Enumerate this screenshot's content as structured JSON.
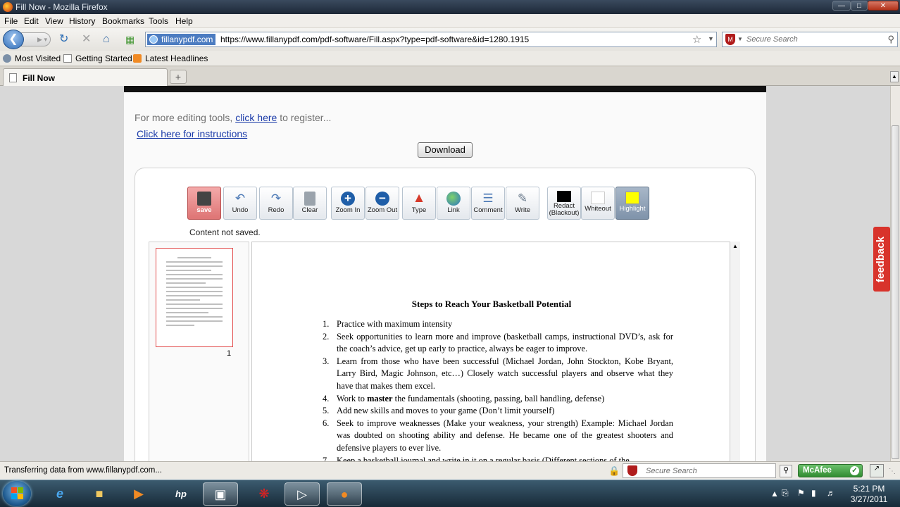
{
  "window": {
    "title": "Fill Now - Mozilla Firefox"
  },
  "menu": [
    "File",
    "Edit",
    "View",
    "History",
    "Bookmarks",
    "Tools",
    "Help"
  ],
  "nav": {
    "site_label": "fillanypdf.com",
    "url": "https://www.fillanypdf.com/pdf-software/Fill.aspx?type=pdf-software&id=1280.1915",
    "search_placeholder": "Secure Search"
  },
  "bookmarks": [
    "Most Visited",
    "Getting Started",
    "Latest Headlines"
  ],
  "tabs": [
    {
      "label": "Fill Now"
    }
  ],
  "page": {
    "edit_prefix": "For more editing tools,",
    "edit_link": "click here",
    "edit_suffix": "to register...",
    "instructions": "Click here for instructions",
    "download": "Download",
    "status": "Content not saved.",
    "thumb_page": "1",
    "feedback": "feedback"
  },
  "toolbar": [
    {
      "label": "save",
      "icon": "floppy-icon"
    },
    {
      "label": "Undo",
      "icon": "undo-icon"
    },
    {
      "label": "Redo",
      "icon": "redo-icon"
    },
    {
      "label": "Clear",
      "icon": "trash-icon"
    },
    {
      "label": "Zoom In",
      "icon": "zoom-in-icon"
    },
    {
      "label": "Zoom Out",
      "icon": "zoom-out-icon"
    },
    {
      "label": "Type",
      "icon": "type-icon"
    },
    {
      "label": "Link",
      "icon": "link-icon"
    },
    {
      "label": "Comment",
      "icon": "comment-icon"
    },
    {
      "label": "Write",
      "icon": "pencil-icon"
    },
    {
      "label": "Redact (Blackout)",
      "icon": "black-square-icon"
    },
    {
      "label": "Whiteout",
      "icon": "white-square-icon"
    },
    {
      "label": "Highlight",
      "icon": "yellow-square-icon"
    }
  ],
  "document": {
    "title": "Steps to Reach Your Basketball Potential",
    "steps": [
      {
        "num": "1.",
        "text": "Practice with maximum intensity"
      },
      {
        "num": "2.",
        "text": "Seek opportunities to learn more and improve (basketball camps, instructional DVD’s, ask for the coach’s advice, get up early to practice, always be eager to improve."
      },
      {
        "num": "3.",
        "text": "Learn from those who have been successful (Michael Jordan, John Stockton, Kobe Bryant, Larry Bird, Magic Johnson, etc…) Closely watch successful players and observe what they have that makes them excel."
      },
      {
        "num": "4.",
        "pre": "Work to",
        "bold": "master",
        "post": "the fundamentals (shooting, passing, ball handling, defense)"
      },
      {
        "num": "5.",
        "text": "Add new skills and moves to your game (Don’t limit yourself)"
      },
      {
        "num": "6.",
        "text": "Seek to improve weaknesses (Make your weakness, your strength) Example: Michael Jordan was doubted on shooting ability and defense. He became one of the greatest shooters and defensive players to ever live."
      },
      {
        "num": "7.",
        "text": "Keep a basketball journal and write in it on a regular basis (Different sections of the"
      }
    ]
  },
  "statusbar": {
    "text": "Transferring data from www.fillanypdf.com...",
    "search_placeholder": "Secure Search",
    "mcafee": "McAfee"
  },
  "clock": {
    "time": "5:21 PM",
    "date": "3/27/2011"
  },
  "colors": {
    "accent": "#1a3aa8",
    "save": "#de7474",
    "highlight": "#ffff00",
    "feedback": "#d8332b"
  }
}
